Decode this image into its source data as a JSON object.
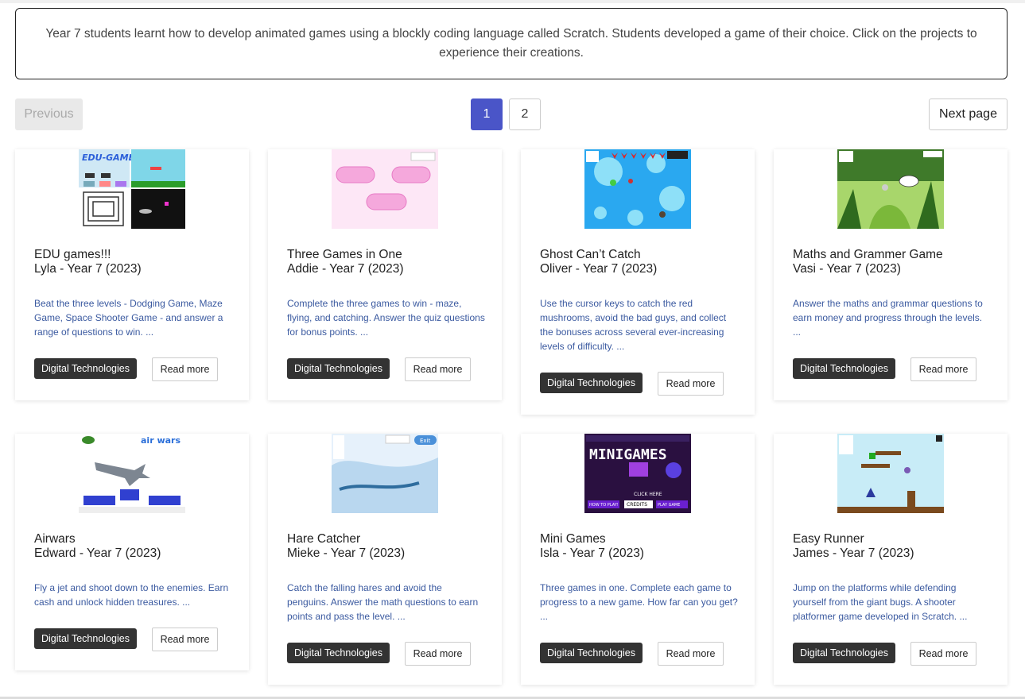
{
  "intro": {
    "text": "Year 7 students learnt how to develop animated games using a blockly coding language called Scratch. Students developed a game of their choice. Click on the projects to experience their creations."
  },
  "pagination": {
    "previous": "Previous",
    "pages": [
      "1",
      "2"
    ],
    "active_page": "1",
    "next": "Next page"
  },
  "cards": [
    {
      "title": "EDU games!!!",
      "author": "Lyla - Year 7 (2023)",
      "description": "Beat the three levels - Dodging Game, Maze Game, Space Shooter Game - and answer a range of questions to win. ...",
      "tag": "Digital Technologies",
      "read_more": "Read more",
      "thumb_icon": "edu-games-thumbnail-icon"
    },
    {
      "title": "Three Games in One",
      "author": "Addie - Year 7 (2023)",
      "description": "Complete the three games to win - maze, flying, and catching. Answer the quiz questions for bonus points. ...",
      "tag": "Digital Technologies",
      "read_more": "Read more",
      "thumb_icon": "three-games-thumbnail-icon"
    },
    {
      "title": "Ghost Can’t Catch",
      "author": "Oliver - Year 7 (2023)",
      "description": "Use the cursor keys to catch the red mushrooms, avoid the bad guys, and collect the bonuses across several ever-increasing levels of difficulty. ...",
      "tag": "Digital Technologies",
      "read_more": "Read more",
      "thumb_icon": "ghost-thumbnail-icon"
    },
    {
      "title": "Maths and Grammer Game",
      "author": "Vasi - Year 7 (2023)",
      "description": "Answer the maths and grammar questions to earn money and progress through the levels. ...",
      "tag": "Digital Technologies",
      "read_more": "Read more",
      "thumb_icon": "jungle-thumbnail-icon"
    },
    {
      "title": "Airwars",
      "author": "Edward - Year 7 (2023)",
      "description": "Fly a jet and shoot down to the enemies. Earn cash and unlock hidden treasures. ...",
      "tag": "Digital Technologies",
      "read_more": "Read more",
      "thumb_icon": "airwars-thumbnail-icon",
      "thumb_text": "air wars"
    },
    {
      "title": "Hare Catcher",
      "author": "Mieke - Year 7 (2023)",
      "description": "Catch the falling hares and avoid the penguins. Answer the math questions to earn points and pass the level. ...",
      "tag": "Digital Technologies",
      "read_more": "Read more",
      "thumb_icon": "snow-thumbnail-icon",
      "thumb_text": "Exit"
    },
    {
      "title": "Mini Games",
      "author": "Isla - Year 7 (2023)",
      "description": "Three games in one. Complete each game to progress to a new game. How far can you get? ...",
      "tag": "Digital Technologies",
      "read_more": "Read more",
      "thumb_icon": "minigames-thumbnail-icon",
      "thumb_text": "MINIGAMES",
      "thumb_sub": "CLICK HERE",
      "thumb_btn1": "HOW TO PLAY!",
      "thumb_btn2": "CREDITS",
      "thumb_btn3": "PLAY GAME"
    },
    {
      "title": "Easy Runner",
      "author": "James - Year 7 (2023)",
      "description": "Jump on the platforms while defending yourself from the giant bugs. A shooter platformer game developed in Scratch. ...",
      "tag": "Digital Technologies",
      "read_more": "Read more",
      "thumb_icon": "runner-thumbnail-icon"
    }
  ],
  "colors": {
    "accent": "#4a55c8",
    "tag_bg": "#333333",
    "desc_text": "#3b5aa0"
  }
}
